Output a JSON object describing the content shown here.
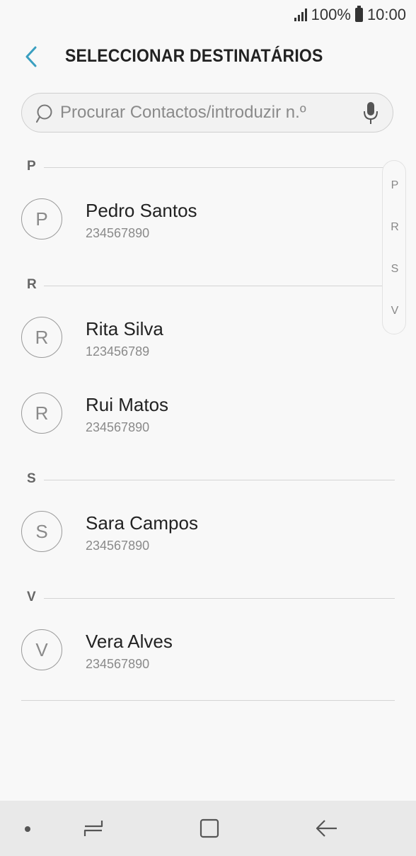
{
  "status_bar": {
    "battery": "100%",
    "time": "10:00"
  },
  "header": {
    "title": "SELECCIONAR DESTINATÁRIOS"
  },
  "search": {
    "placeholder": "Procurar Contactos/introduzir n.º"
  },
  "sections": {
    "p": {
      "letter": "P"
    },
    "r": {
      "letter": "R"
    },
    "s": {
      "letter": "S"
    },
    "v": {
      "letter": "V"
    }
  },
  "contacts": [
    {
      "initial": "P",
      "name": "Pedro Santos",
      "number": "234567890"
    },
    {
      "initial": "R",
      "name": "Rita Silva",
      "number": "123456789"
    },
    {
      "initial": "R",
      "name": "Rui Matos",
      "number": "234567890"
    },
    {
      "initial": "S",
      "name": "Sara Campos",
      "number": "234567890"
    },
    {
      "initial": "V",
      "name": "Vera Alves",
      "number": "234567890"
    }
  ],
  "index_bar": [
    "P",
    "R",
    "S",
    "V"
  ],
  "colors": {
    "accent": "#3a9fc0",
    "background": "#f8f8f8",
    "nav_bar": "#e9e9e9"
  },
  "icons": [
    "signal-icon",
    "battery-icon",
    "back-arrow-icon",
    "search-icon",
    "mic-icon",
    "recents-icon",
    "home-icon",
    "back-icon"
  ]
}
